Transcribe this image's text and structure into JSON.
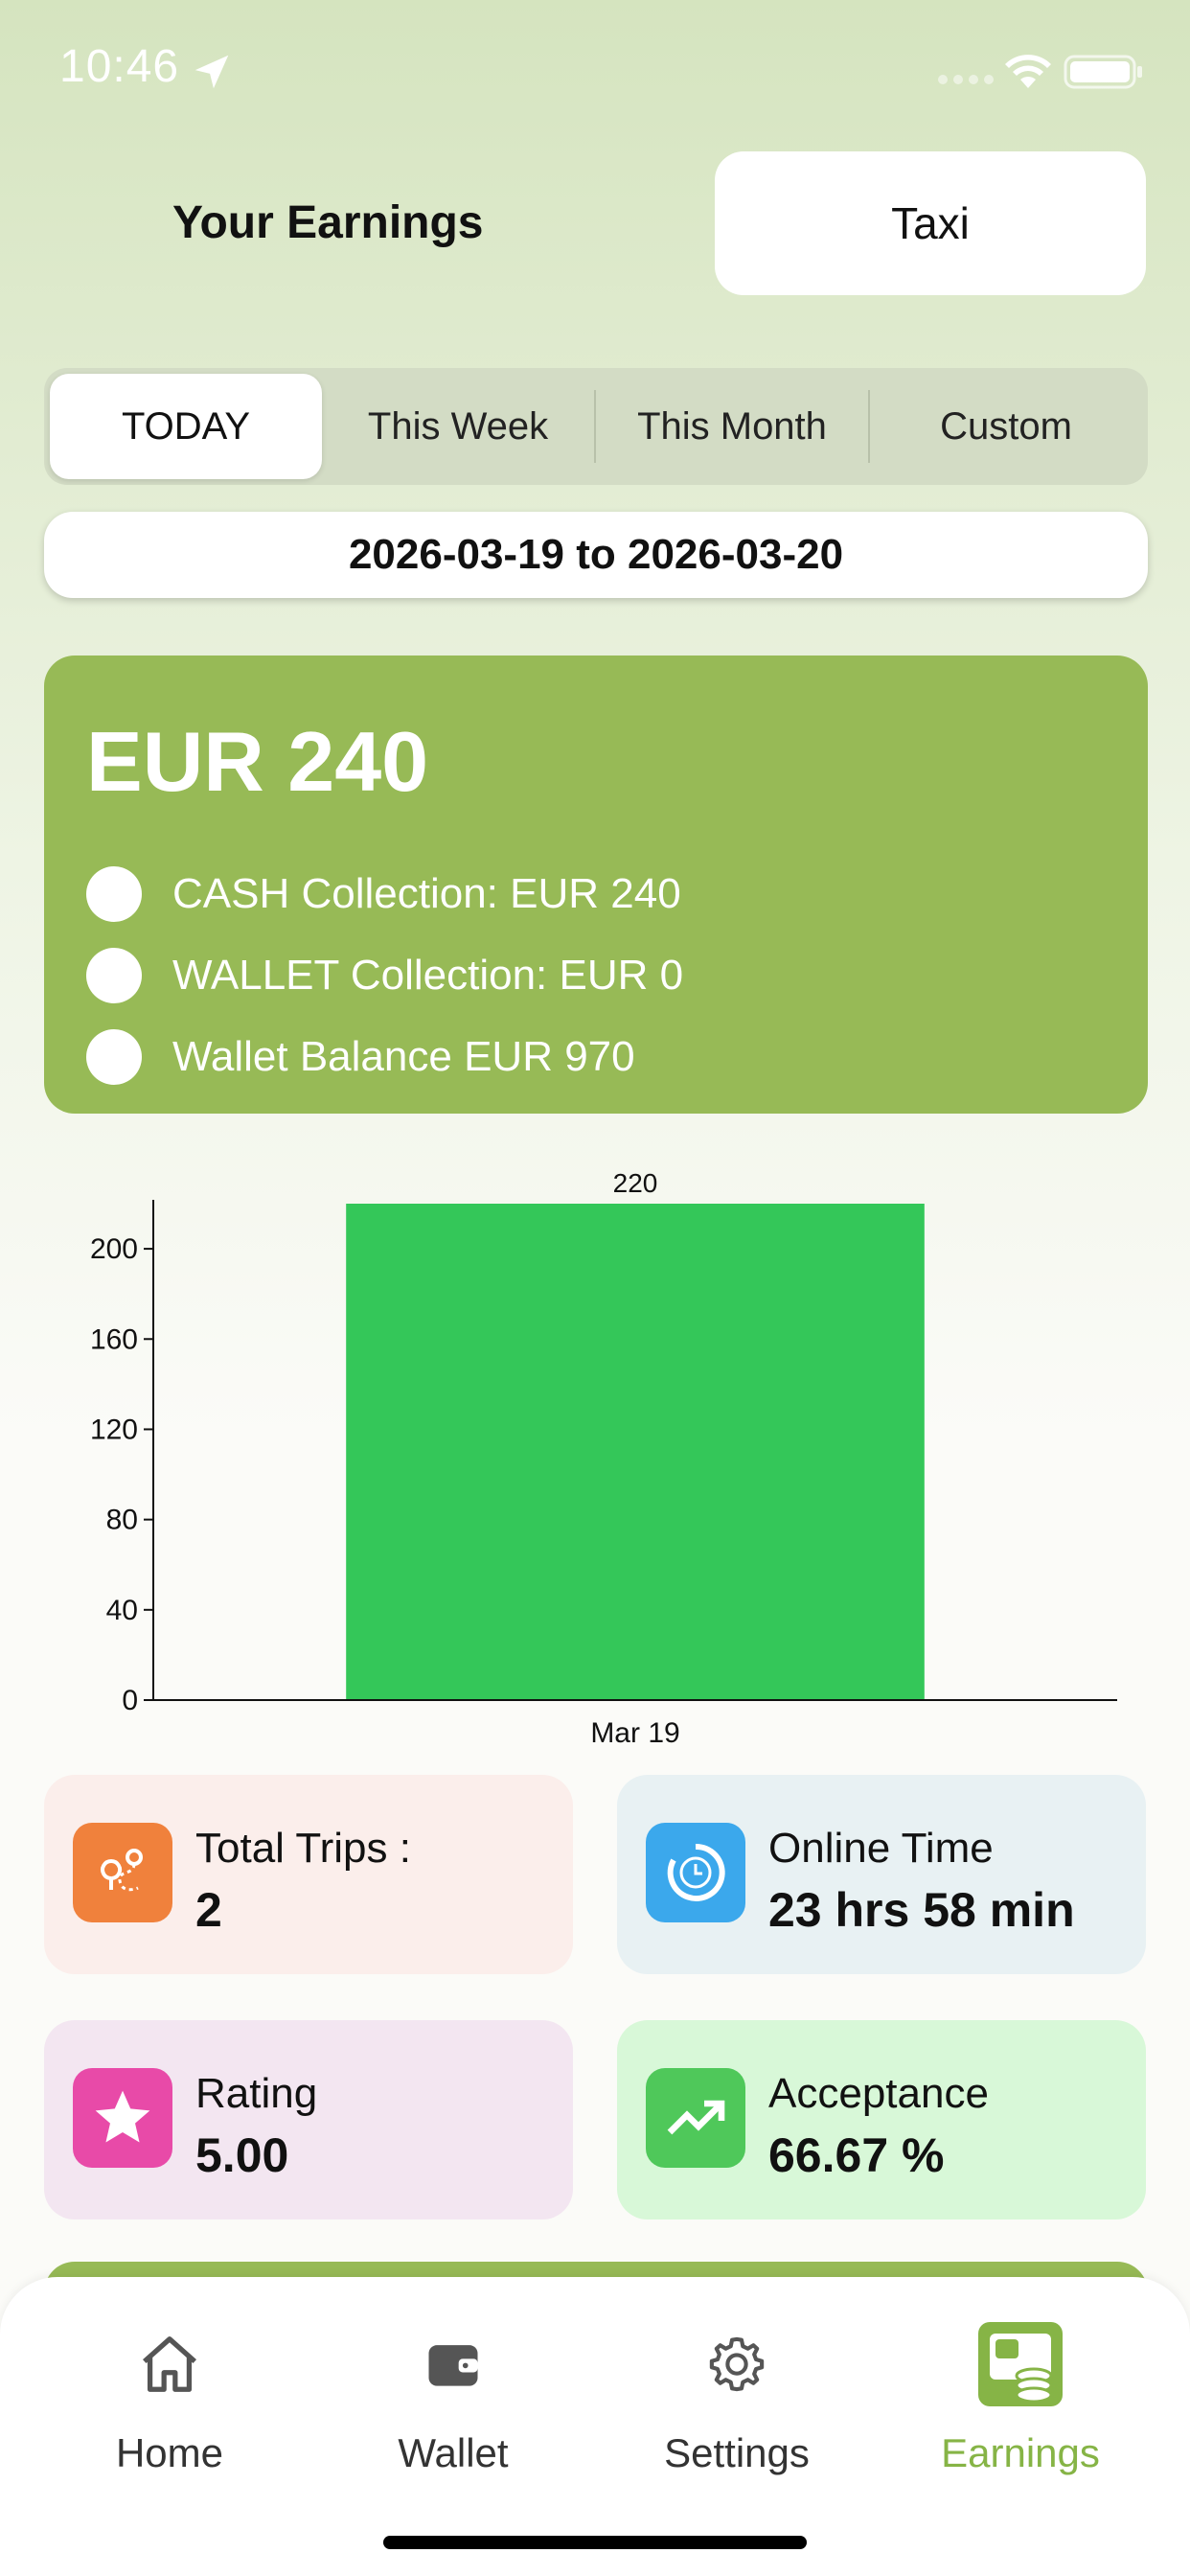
{
  "status_bar": {
    "time": "10:46"
  },
  "header": {
    "title": "Your Earnings",
    "service": "Taxi"
  },
  "segments": [
    "TODAY",
    "This Week",
    "This Month",
    "Custom"
  ],
  "date_range": "2026-03-19 to 2026-03-20",
  "earnings": {
    "total": "EUR 240",
    "rows": [
      "CASH Collection:  EUR 240",
      "WALLET Collection:  EUR 0",
      "Wallet Balance EUR 970"
    ]
  },
  "chart_data": {
    "type": "bar",
    "categories": [
      "Mar 19"
    ],
    "values": [
      220
    ],
    "data_labels": [
      "220"
    ],
    "ylim": [
      0,
      220
    ],
    "yticks": [
      0,
      40,
      80,
      120,
      160,
      200
    ],
    "colors": {
      "bar": "#34c759"
    },
    "grid": false
  },
  "stats": {
    "trips": {
      "label": "Total Trips :",
      "value": "2",
      "icon": "route-icon",
      "color": "#f0813c"
    },
    "online": {
      "label": "Online Time",
      "value": "23 hrs 58 min",
      "icon": "clock-icon",
      "color": "#3ba8ec"
    },
    "rating": {
      "label": "Rating",
      "value": "5.00",
      "icon": "star-icon",
      "color": "#e84aa8"
    },
    "acceptance": {
      "label": "Acceptance",
      "value": "66.67 %",
      "icon": "trend-up-icon",
      "color": "#4fc85a"
    }
  },
  "tabs": [
    {
      "label": "Home",
      "icon": "home-icon"
    },
    {
      "label": "Wallet",
      "icon": "wallet-icon"
    },
    {
      "label": "Settings",
      "icon": "gear-icon"
    },
    {
      "label": "Earnings",
      "icon": "earnings-icon"
    }
  ],
  "colors": {
    "accent": "#97ba56",
    "active_tab": "#86b446"
  }
}
